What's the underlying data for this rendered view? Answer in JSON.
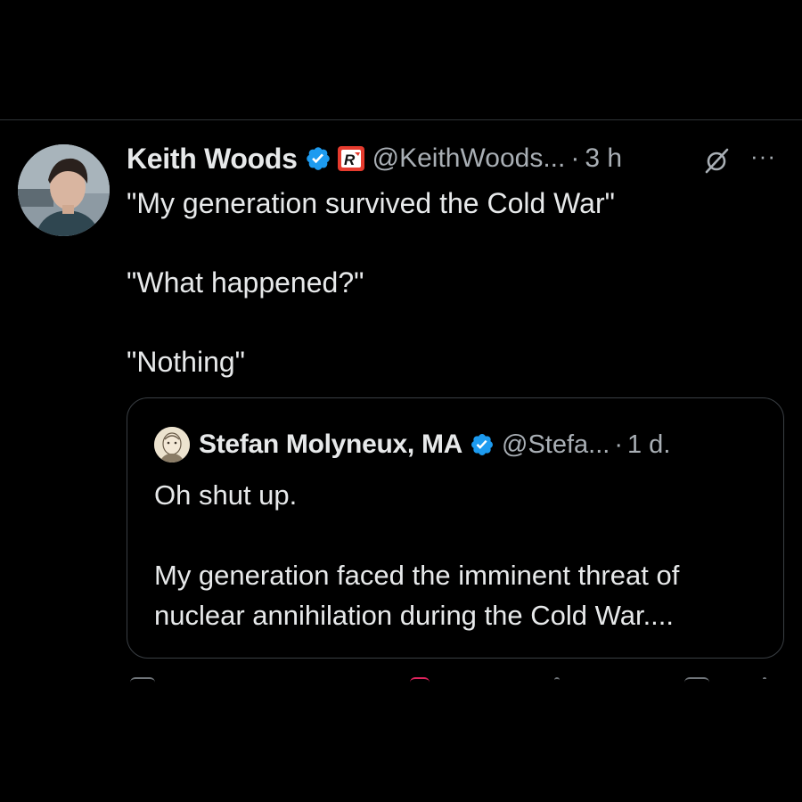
{
  "tweet": {
    "author_name": "Keith Woods",
    "handle": "@KeithWoods...",
    "separator": "·",
    "time": "3 h",
    "more_label": "···",
    "body": [
      "\"My generation survived the Cold War\"",
      "\"What happened?\"",
      "\"Nothing\""
    ]
  },
  "quote": {
    "author_name": "Stefan Molyneux, MA",
    "handle": "@Stefa...",
    "separator": "·",
    "time": "1 d.",
    "body_line1": "Oh shut up.",
    "body_line2": "My generation faced the imminent threat of",
    "body_line3": "nuclear annihilation during the Cold War...."
  },
  "icons": {
    "verified": "verified-badge-icon",
    "affiliation": "affiliation-badge-icon",
    "grok": "grok-icon",
    "more": "more-icon"
  },
  "colors": {
    "background": "#000000",
    "text_primary": "#e7e9ea",
    "text_secondary": "#a9afb5",
    "verified_blue": "#1d9bf0",
    "affiliation_red": "#e0245e",
    "border": "#3a3f44"
  }
}
